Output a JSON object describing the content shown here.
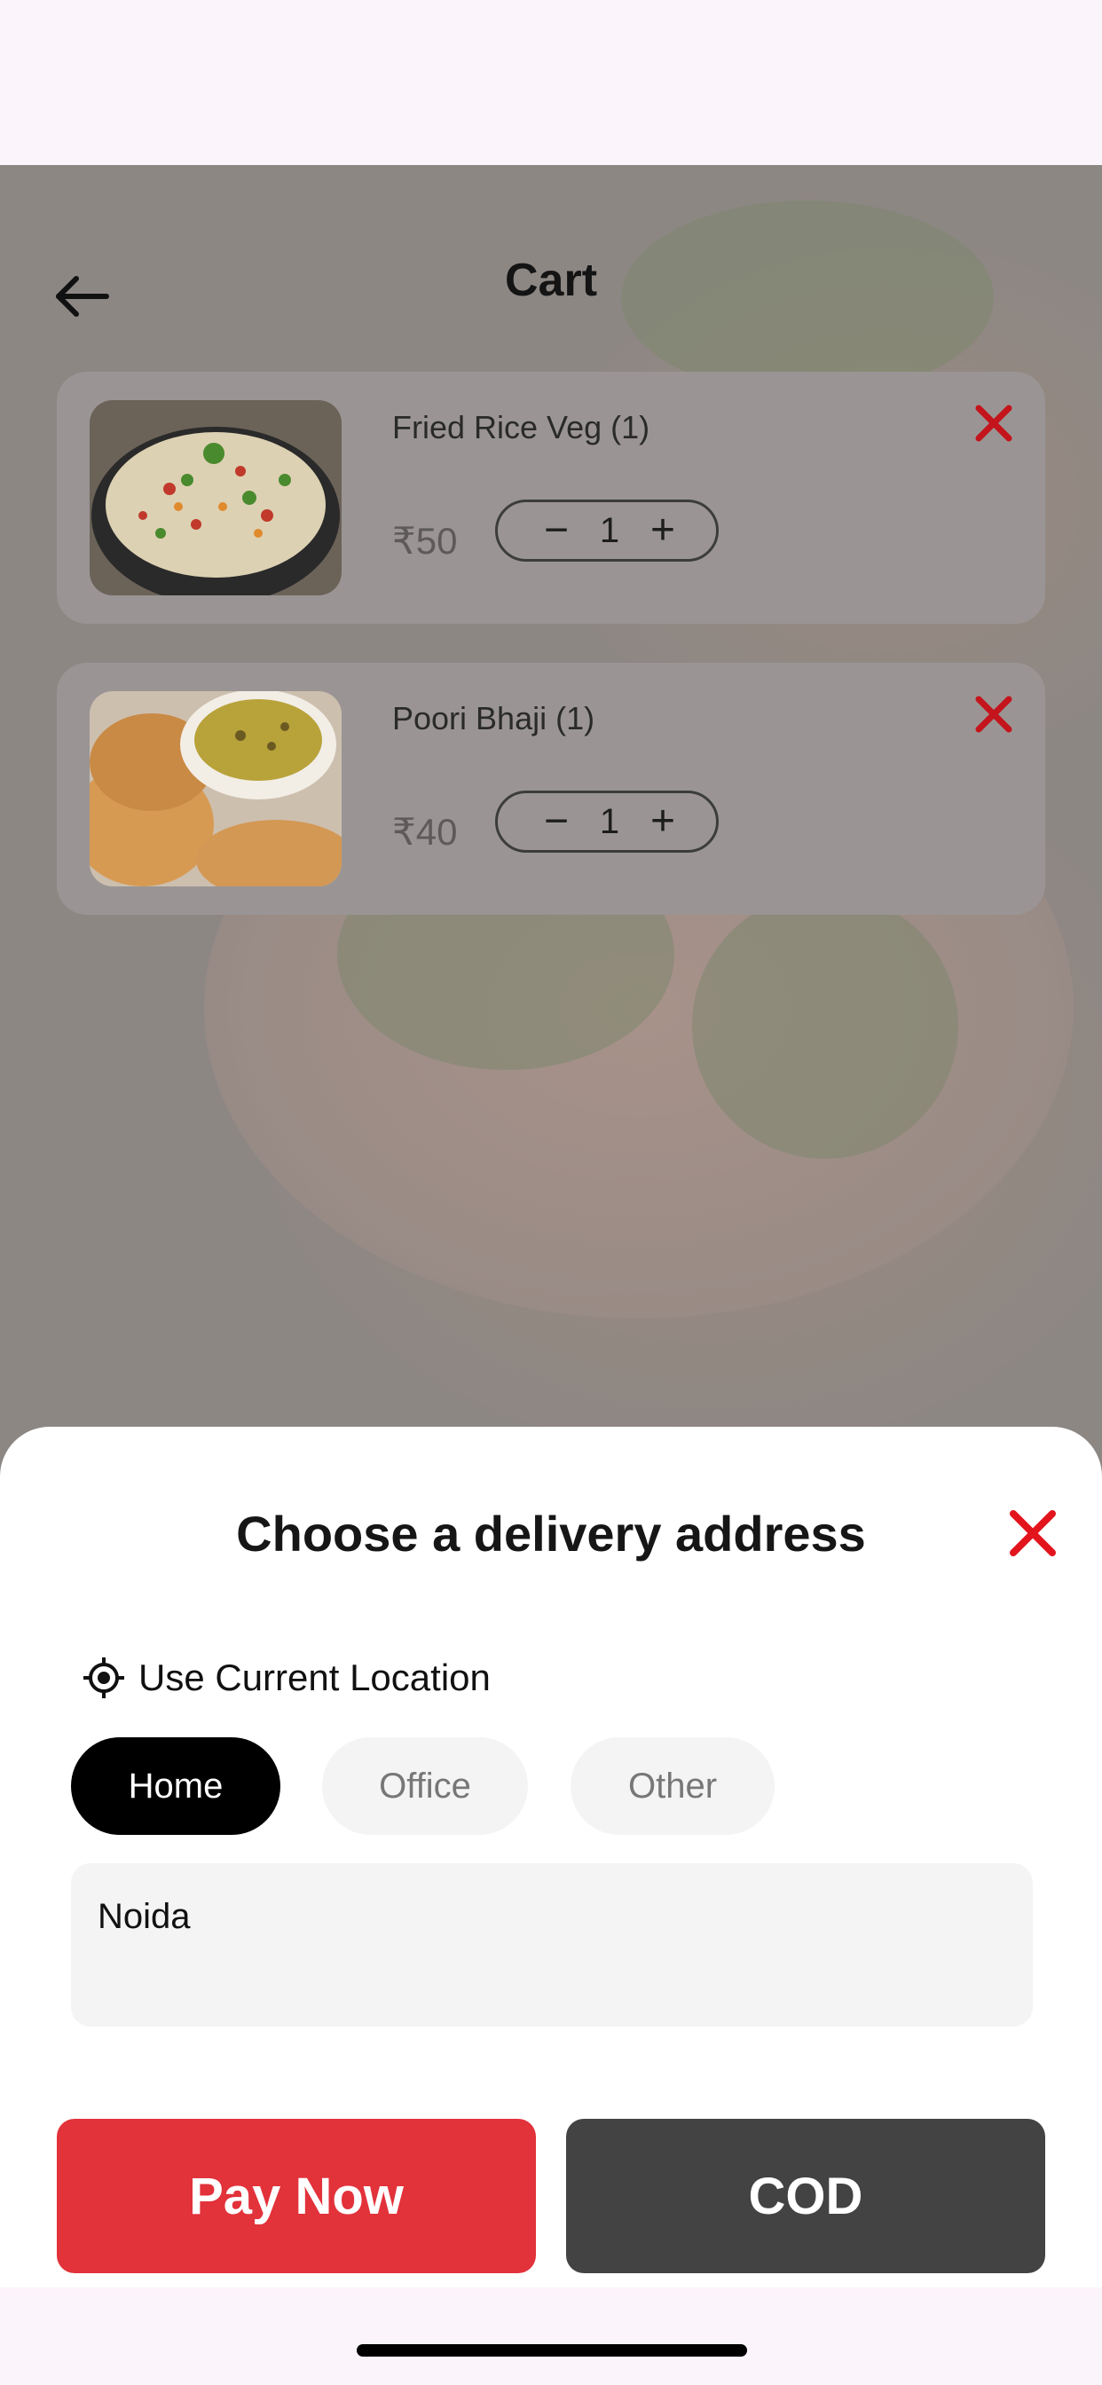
{
  "header": {
    "title": "Cart",
    "back_icon": "arrow-left-icon"
  },
  "cart": {
    "items": [
      {
        "name": "Fried Rice Veg (1)",
        "price": "₹50",
        "quantity": "1"
      },
      {
        "name": "Poori Bhaji (1)",
        "price": "₹40",
        "quantity": "1"
      }
    ],
    "decrement_symbol": "−",
    "increment_symbol": "+"
  },
  "sheet": {
    "title": "Choose a delivery address",
    "use_location_label": "Use Current Location",
    "address_types": [
      "Home",
      "Office",
      "Other"
    ],
    "selected_type": "Home",
    "address_value": "Noida",
    "pay_now_label": "Pay Now",
    "cod_label": "COD"
  },
  "colors": {
    "accent_red": "#e2323a",
    "remove_icon_red": "#c4141c",
    "cod_dark": "#434343",
    "chip_selected": "#000000"
  }
}
